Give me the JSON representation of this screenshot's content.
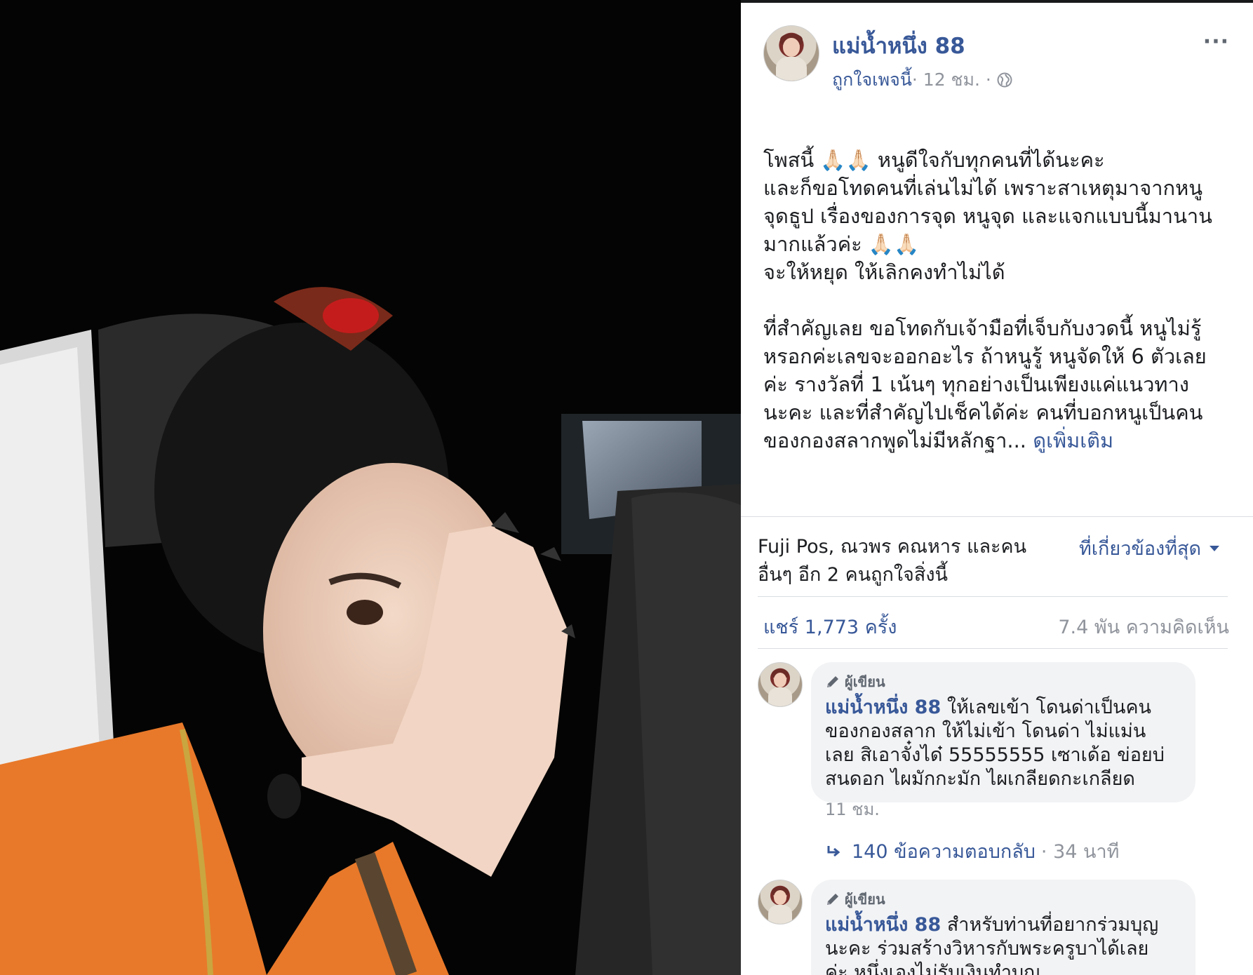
{
  "post": {
    "page_name": "แม่น้ำหนึ่ง 88",
    "like_page": "ถูกใจเพจนี้",
    "time": " · 12 ชม. · ",
    "more": "···",
    "text_lines": [
      "โพสนี้ 🙏🏻🙏🏻 หนูดีใจกับทุกคนที่ได้นะคะ",
      "และก็ขอโทดคนที่เล่นไม่ได้ เพราะสาเหตุมาจากหนู",
      "จุดธูป เรื่องของการจุด หนูจุด และแจกแบบนี้มานาน",
      "มากแล้วค่ะ 🙏🏻🙏🏻",
      "จะให้หยุด ให้เลิกคงทำไม่ได้",
      "ที่สำคัญเลย ขอโทดกับเจ้ามือที่เจ็บกับงวดนี้ หนูไม่รู้",
      "หรอกค่ะเลขจะออกอะไร ถ้าหนูรู้ หนูจัดให้ 6 ตัวเลย",
      "ค่ะ รางวัลที่ 1 เน้นๆ ทุกอย่างเป็นเพียงแค่แนวทาง",
      "นะคะ และที่สำคัญไปเช็คได้ค่ะ คนที่บอกหนูเป็นคน",
      "ของกองสลากพูดไม่มีหลักฐา... "
    ],
    "see_more": "ดูเพิ่มเติม"
  },
  "reactions": {
    "likers_line1": "Fuji Pos, ณวพร คณหาร และคน",
    "likers_line2": "อื่นๆ อีก 2 คนถูกใจสิ่งนี้",
    "sort_label": "ที่เกี่ยวข้องที่สุด",
    "shares": "แชร์ 1,773 ครั้ง",
    "comments": "7.4 พัน ความคิดเห็น"
  },
  "comments": [
    {
      "tag": "ผู้เขียน",
      "author": "แม่น้ำหนึ่ง 88",
      "line1": " ให้เลขเข้า โดนด่าเป็นคน",
      "line2": "ของกองสลาก ให้ไม่เข้า โดนด่า ไม่แม่น",
      "line3": "เลย สิเอาจั๋งได๋ 55555555 เซาเด้อ ข่อยบ่",
      "line4": "สนดอก ไผมักกะมัก ไผเกลียดกะเกลียด",
      "time": "11 ชม.",
      "replies": "140 ข้อความตอบกลับ",
      "reply_time": " · 34 นาที"
    },
    {
      "tag": "ผู้เขียน",
      "author": "แม่น้ำหนึ่ง 88",
      "line1": " สำหรับท่านที่อยากร่วมบุญ",
      "line2": "นะคะ ร่วมสร้างวิหารกับพระครูบาได้เลย",
      "line3": "ค่ะ หนึ่งเองไม่รับเงินทำบุญ"
    }
  ],
  "icons": {
    "more": "more-options-icon",
    "globe": "globe-icon",
    "pencil": "pencil-icon",
    "reply": "reply-arrow-icon"
  },
  "colors": {
    "link": "#385898",
    "meta": "#90949c",
    "bubble": "#f2f3f5",
    "shirt": "#e8792a"
  }
}
